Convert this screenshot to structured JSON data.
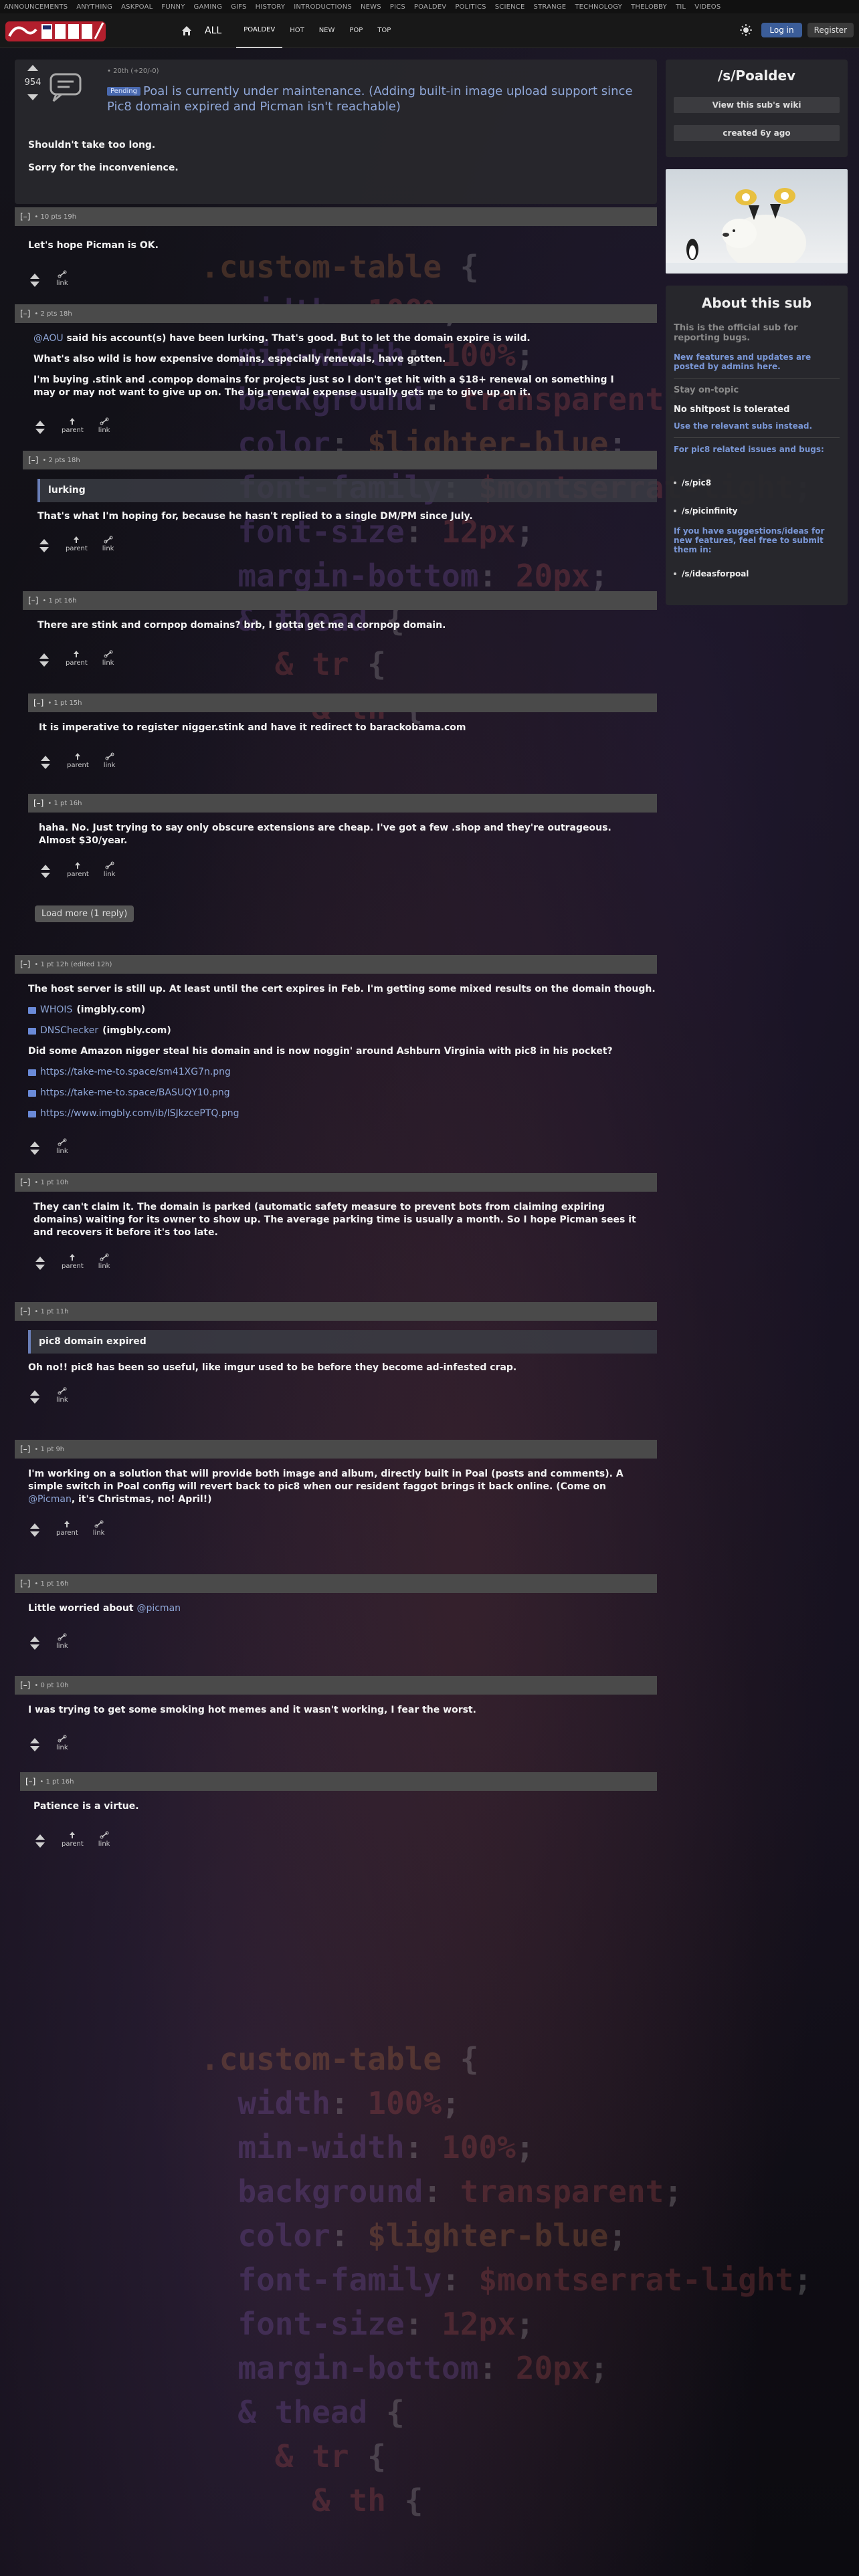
{
  "topbar": [
    "ANNOUNCEMENTS",
    "ANYTHING",
    "ASKPOAL",
    "FUNNY",
    "GAMING",
    "GIFS",
    "HISTORY",
    "INTRODUCTIONS",
    "NEWS",
    "PICS",
    "POALDEV",
    "POLITICS",
    "SCIENCE",
    "STRANGE",
    "TECHNOLOGY",
    "THELOBBY",
    "TIL",
    "VIDEOS"
  ],
  "header": {
    "logo_text": "POAL",
    "nav_all": "ALL",
    "nav_items": [
      "POALDEV",
      "HOT",
      "NEW",
      "POP",
      "TOP"
    ],
    "login": "Log in",
    "register": "Register"
  },
  "post": {
    "score": "954",
    "meta": "• 20th (+20/-0)",
    "badge": "Pending",
    "title": "Poal is currently under maintenance. (Adding built-in image upload support since Pic8 domain expired and Picman isn't reachable)",
    "body": [
      "Shouldn't take too long.",
      "Sorry for the inconvenience."
    ]
  },
  "comments": [
    {
      "meta": "• 10 pts 19h",
      "text": "Let's hope Picman is OK.",
      "link": "link"
    },
    {
      "meta": "• 2 pts 18h",
      "p1_user": "@AOU",
      "p1": " said his account(s) have been lurking. That's good. But to let the domain expire is wild.",
      "p2": "What's also wild is how expensive domains, especially renewals, have gotten.",
      "p3": "I'm buying .stink and .compop domains for projects just so I don't get hit with a $18+ renewal on something I may or may not want to give up on. The big renewal expense usually gets me to give up on it.",
      "parent": "parent",
      "link": "link"
    },
    {
      "meta": "• 2 pts 18h",
      "quote": "lurking",
      "text": "That's what I'm hoping for, because he hasn't replied to a single DM/PM since July.",
      "parent": "parent",
      "link": "link"
    },
    {
      "meta": "• 1 pt 16h",
      "text": "There are stink and cornpop domains? brb, I gotta get me a cornpop domain.",
      "parent": "parent",
      "link": "link"
    },
    {
      "meta": "• 1 pt 15h",
      "text": "It is imperative to register nigger.stink and have it redirect to barackobama.com",
      "parent": "parent",
      "link": "link"
    },
    {
      "meta": "• 1 pt 16h",
      "text": "haha. No. Just trying to say only obscure extensions are cheap. I've got a few .shop and they're outrageous. Almost $30/year.",
      "parent": "parent",
      "link": "link",
      "load_more": "Load more (1 reply)"
    },
    {
      "meta": "• 1 pt 12h (edited 12h)",
      "text": "The host server is still up. At least until the cert expires in Feb. I'm getting some mixed results on the domain though.",
      "links": [
        {
          "a": "WHOIS",
          "b": "(imgbly.com)"
        },
        {
          "a": "DNSChecker",
          "b": "(imgbly.com)"
        }
      ],
      "text2": "Did some Amazon nigger steal his domain and is now noggin' around Ashburn Virginia with pic8 in his pocket?",
      "urls": [
        "https://take-me-to.space/sm41XG7n.png",
        "https://take-me-to.space/BASUQY10.png",
        "https://www.imgbly.com/ib/lSJkzcePTQ.png"
      ],
      "link": "link"
    },
    {
      "meta": "• 1 pt 10h",
      "text": "They can't claim it. The domain is parked (automatic safety measure to prevent bots from claiming expiring domains) waiting for its owner to show up. The average parking time is usually a month. So I hope Picman sees it and recovers it before it's too late.",
      "parent": "parent",
      "link": "link"
    },
    {
      "meta": "• 1 pt 11h",
      "quote": "pic8 domain expired",
      "text": "Oh no!! pic8 has been so useful, like imgur used to be before they become ad-infested crap.",
      "link": "link"
    },
    {
      "meta": "• 1 pt 9h",
      "text_a": "I'm working on a solution that will provide both image and album, directly built in Poal (posts and comments). A simple switch in Poal config will revert back to pic8 when our resident faggot brings it back online. (Come on ",
      "user": "@Picman",
      "text_b": ", it's Christmas, no! April!)",
      "parent": "parent",
      "link": "link"
    },
    {
      "meta": "• 1 pt 16h",
      "text": "Little worried about ",
      "user": "@picman",
      "link": "link"
    },
    {
      "meta": "• 0 pt 10h",
      "text": "I was trying to get some smoking hot memes and it wasn't working, I fear the worst.",
      "link": "link"
    },
    {
      "meta": "• 1 pt 16h",
      "text": "Patience is a virtue.",
      "parent": "parent",
      "link": "link"
    }
  ],
  "sidebar": {
    "title": "/s/Poaldev",
    "wiki": "View this sub's wiki",
    "created": "created 6y ago",
    "about_title": "About this sub",
    "desc": "This is the official sub for reporting bugs.",
    "desc2": "New features and updates are posted by admins here.",
    "stay": "Stay on-topic",
    "no_shit": "No shitpost is tolerated",
    "use_relevant": "Use the relevant subs instead.",
    "pic8_bugs": "For pic8 related issues and bugs:",
    "sub1": "/s/pic8",
    "sub2": "/s/picinfinity",
    "suggest": "If you have suggestions/ideas for new features, feel free to submit them in:",
    "sub3": "/s/ideasforpoal"
  },
  "colors": {
    "accent": "#8fa7d8",
    "login": "#3b5d99",
    "panel": "#28282c",
    "comment_head": "#4a4a4a"
  }
}
